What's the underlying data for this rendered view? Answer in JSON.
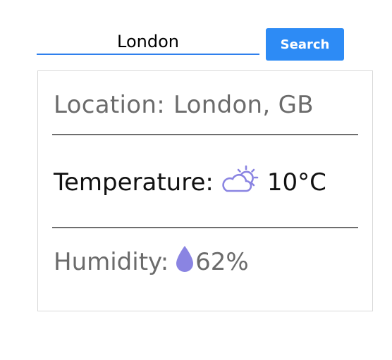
{
  "search": {
    "value": "London",
    "button_label": "Search"
  },
  "weather": {
    "location_label": "Location:",
    "location_value": "London, GB",
    "temperature_label": "Temperature:",
    "temperature_value": "10°C",
    "temperature_icon": "partly-cloudy-icon",
    "humidity_label": "Humidity:",
    "humidity_value": "62%",
    "humidity_icon": "water-drop-icon"
  },
  "colors": {
    "accent": "#2d8bf5",
    "icon": "#8a84e2"
  }
}
